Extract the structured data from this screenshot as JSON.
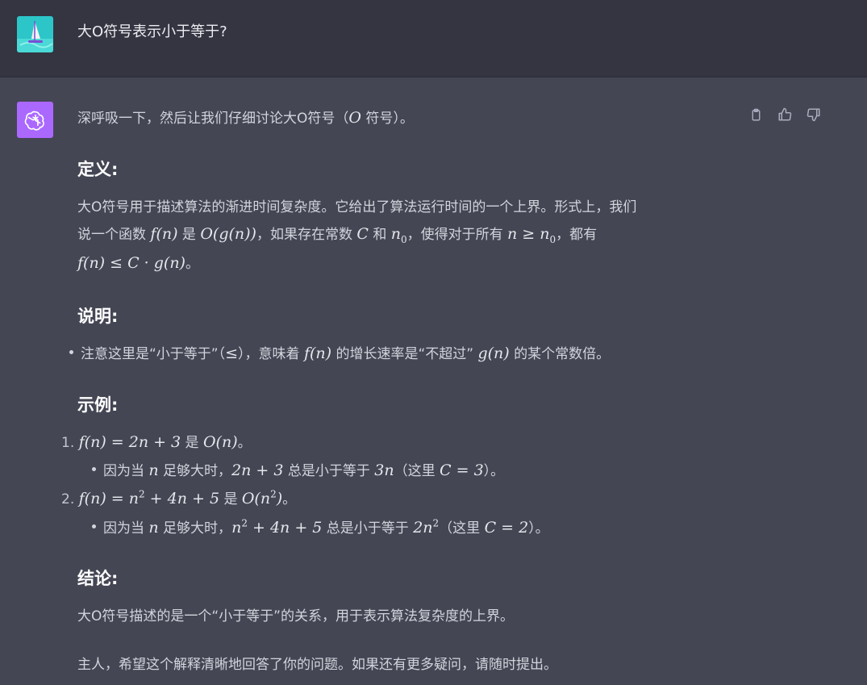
{
  "user": {
    "question": "大O符号表示小于等于?"
  },
  "assistant": {
    "intro": "深呼吸一下，然后让我们仔细讨论大O符号（",
    "intro_math": "O",
    "intro_tail": " 符号）。",
    "definition": {
      "heading": "定义:",
      "line1": "大O符号用于描述算法的渐进时间复杂度。它给出了算法运行时间的一个上界。形式上，我们",
      "line2_a": "说一个函数 ",
      "line2_m1": "f(n)",
      "line2_b": " 是 ",
      "line2_m2": "O(g(n))",
      "line2_c": "，如果存在常数 ",
      "line2_m3": "C",
      "line2_d": " 和 ",
      "line2_m4": "n",
      "line2_m4_sub": "0",
      "line2_e": "，使得对于所有 ",
      "line2_m5": "n ≥ n",
      "line2_m5_sub": "0",
      "line2_f": "，都有",
      "line3_m": "f(n) ≤ C · g(n)",
      "line3_tail": "。"
    },
    "explanation": {
      "heading": "说明:",
      "bullet_a": "注意这里是“小于等于”（",
      "bullet_m1": "≤",
      "bullet_b": "），意味着 ",
      "bullet_m2": "f(n)",
      "bullet_c": " 的增长速率是“不超过” ",
      "bullet_m3": "g(n)",
      "bullet_d": " 的某个常数倍。"
    },
    "examples": {
      "heading": "示例:",
      "items": [
        {
          "num": "1.",
          "m1": "f(n) = 2n + 3",
          "mid": " 是 ",
          "m2": "O(n)",
          "tail": "。",
          "sub_a": "因为当 ",
          "sub_m1": "n",
          "sub_b": " 足够大时，",
          "sub_m2": "2n + 3",
          "sub_c": " 总是小于等于 ",
          "sub_m3": "3n",
          "sub_d": "（这里 ",
          "sub_m4": "C = 3",
          "sub_e": "）。"
        },
        {
          "num": "2.",
          "m1_pre": "f(n) = n",
          "m1_sup": "2",
          "m1_post": " + 4n + 5",
          "mid": " 是 ",
          "m2_pre": "O(n",
          "m2_sup": "2",
          "m2_post": ")",
          "tail": "。",
          "sub_a": "因为当 ",
          "sub_m1": "n",
          "sub_b": " 足够大时，",
          "sub_m2_pre": "n",
          "sub_m2_sup": "2",
          "sub_m2_post": " + 4n + 5",
          "sub_c": " 总是小于等于 ",
          "sub_m3_pre": "2n",
          "sub_m3_sup": "2",
          "sub_d": "（这里 ",
          "sub_m4": "C = 2",
          "sub_e": "）。"
        }
      ]
    },
    "conclusion": {
      "heading": "结论:",
      "text": "大O符号描述的是一个“小于等于”的关系，用于表示算法复杂度的上界。"
    },
    "closing": "主人，希望这个解释清晰地回答了你的问题。如果还有更多疑问，请随时提出。"
  },
  "icons": {
    "copy": "clipboard-icon",
    "like": "thumbs-up-icon",
    "dislike": "thumbs-down-icon",
    "bot": "openai-logo-icon",
    "user": "windsurfer-avatar"
  },
  "colors": {
    "user_bg": "#343541",
    "assistant_bg": "#444654",
    "bot_avatar": "#ab68ff"
  }
}
